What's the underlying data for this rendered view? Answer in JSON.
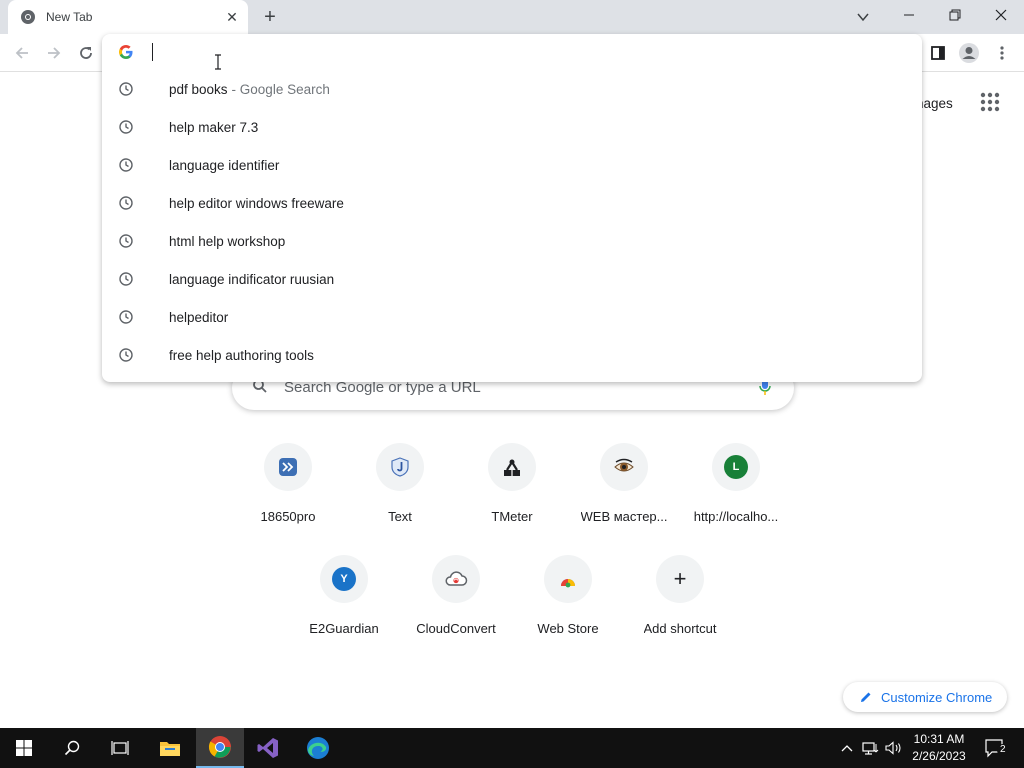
{
  "tab": {
    "title": "New Tab",
    "close": "✕"
  },
  "tabstrip": {
    "new_tab": "+"
  },
  "omnibox": {
    "value": "",
    "suggestions": [
      {
        "text": "pdf books",
        "extra": "- Google Search"
      },
      {
        "text": "help maker 7.3"
      },
      {
        "text": "language identifier"
      },
      {
        "text": "help editor windows freeware"
      },
      {
        "text": "html help workshop"
      },
      {
        "text": "language indificator ruusian"
      },
      {
        "text": "helpeditor"
      },
      {
        "text": "free help authoring tools"
      }
    ]
  },
  "header": {
    "images_link": "nages"
  },
  "search": {
    "placeholder": "Search Google or type a URL"
  },
  "shortcuts": [
    {
      "label": "18650pro",
      "icon": "18650pro-icon"
    },
    {
      "label": "Text",
      "icon": "text-shield-icon"
    },
    {
      "label": "TMeter",
      "icon": "tmeter-icon"
    },
    {
      "label": "WEB мастер...",
      "icon": "eye-icon"
    },
    {
      "label": "http://localho...",
      "icon": "letter-l-icon",
      "letter": "L"
    },
    {
      "label": "E2Guardian",
      "icon": "letter-y-icon",
      "letter": "Y"
    },
    {
      "label": "CloudConvert",
      "icon": "cloudconvert-icon"
    },
    {
      "label": "Web Store",
      "icon": "webstore-icon"
    },
    {
      "label": "Add shortcut",
      "icon": "plus-icon",
      "glyph": "+"
    }
  ],
  "customize": {
    "label": "Customize Chrome"
  },
  "taskbar": {
    "time": "10:31 AM",
    "date": "2/26/2023",
    "notifications": "2"
  },
  "colors": {
    "tabstrip_bg": "#dee1e6",
    "taskbar_bg": "#111111",
    "accent_blue": "#1a73e8",
    "letter_l": "#188038",
    "letter_y": "#1a73c8"
  }
}
